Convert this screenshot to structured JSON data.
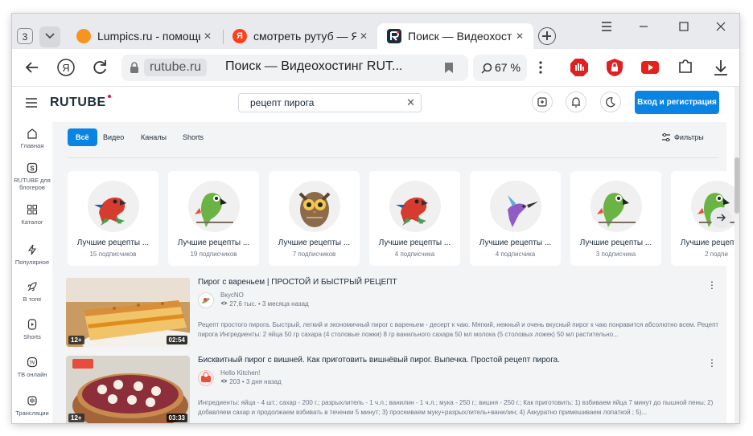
{
  "browser": {
    "tab_count": "3",
    "tabs": [
      {
        "title": "Lumpics.ru - помощь с",
        "favicon_color": "#f7941d"
      },
      {
        "title": "смотреть рутуб — Яндекс",
        "favicon_color": "#fc3f1d"
      },
      {
        "title": "Поиск — Видеохостинг",
        "favicon_color": "#1c2c3c"
      }
    ],
    "address": {
      "domain": "rutube.ru",
      "page_title": "Поиск — Видеохостинг RUT..."
    },
    "zoom": "67 %"
  },
  "header": {
    "logo": "RUTUBE",
    "search_value": "рецепт пирога",
    "login_label": "Вход и регистрация"
  },
  "sidebar": {
    "items": [
      {
        "label": "Главная",
        "icon": "home-icon"
      },
      {
        "label": "RUTUBE для блогеров",
        "icon": "studio-icon"
      },
      {
        "label": "Каталог",
        "icon": "catalog-icon"
      },
      {
        "label": "Популярное",
        "icon": "lightning-icon"
      },
      {
        "label": "В топе",
        "icon": "rocket-icon"
      },
      {
        "label": "Shorts",
        "icon": "shorts-icon"
      },
      {
        "label": "ТВ онлайн",
        "icon": "tv-icon"
      },
      {
        "label": "Трансляции",
        "icon": "broadcast-icon"
      }
    ]
  },
  "filters": {
    "tabs": [
      "Всё",
      "Видео",
      "Каналы",
      "Shorts"
    ],
    "filters_label": "Фильтры"
  },
  "channels": [
    {
      "name": "Лучшие рецепты ...",
      "subs": "15 подписчиков",
      "bird": "red-parrot"
    },
    {
      "name": "Лучшие рецепты ...",
      "subs": "19 подписчиков",
      "bird": "green-parrot"
    },
    {
      "name": "Лучшие рецепты ...",
      "subs": "7 подписчиков",
      "bird": "owl"
    },
    {
      "name": "Лучшие рецепты ...",
      "subs": "4 подписчика",
      "bird": "red-parrot"
    },
    {
      "name": "Лучшие рецепты ...",
      "subs": "4 подписчика",
      "bird": "hummingbird"
    },
    {
      "name": "Лучшие рецепты ...",
      "subs": "3 подписчика",
      "bird": "green-parrot"
    },
    {
      "name": "Лучшие рецепты ...",
      "subs": "2 подпи",
      "bird": "green-parrot"
    }
  ],
  "videos": [
    {
      "title": "Пирог с вареньем | ПРОСТОЙ И БЫСТРЫЙ РЕЦЕПТ",
      "channel": "ВкусNO",
      "views": "27,6 тыс.",
      "date": "3 месяца назад",
      "age": "12+",
      "duration": "02:54",
      "description": "Рецепт простого пирога. Быстрый, легкий и экономичный пирог с вареньем - десерт к чаю. Мягкий, нежный и очень вкусный пирог к чаю понравится абсолютно всем. Рецепт пирога Ингредиенты: 2 яйца 50 гр сахара (4 столовые ложки) 8 гр ванильного сахара 50 мл молока (5 столовых ложек) 50 мл растительно..."
    },
    {
      "title": "Бисквитный пирог с вишней. Как приготовить вишнёвый пирог. Выпечка. Простой рецепт пирога.",
      "channel": "Hello Kitchen!",
      "views": "203",
      "date": "3 дня назад",
      "age": "12+",
      "duration": "03:33",
      "description": "Ингредиенты: яйца - 4 шт.; сахар - 200 г.; разрыхлитель - 1 ч.л.; ванилин - 1 ч.л.; мука - 250 г.; вишня - 250 г.; Как приготовить: 1) взбиваем яйца 7 минут до пышной пены; 2) добавляем сахар и продолжаем взбивать в течении 5 минут; 3) просеиваем муку+разрыхлитель+ванилин; 4) Аккуратно примешиваем лопаткой ; 5)..."
    }
  ]
}
